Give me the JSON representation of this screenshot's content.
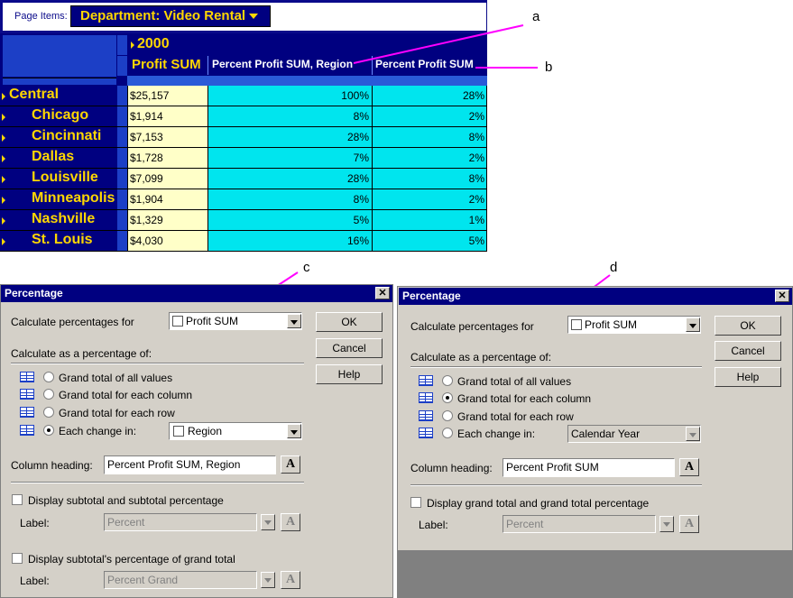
{
  "report": {
    "page_items_label": "Page Items:",
    "department_selector": "Department: Video Rental",
    "year": "2000",
    "columns": [
      "Profit SUM",
      "Percent Profit SUM, Region",
      "Percent Profit SUM"
    ],
    "rows": [
      {
        "label": "Central",
        "profit": "$25,157",
        "pct_region": "100%",
        "pct_total": "28%"
      },
      {
        "label": "Chicago",
        "profit": "$1,914",
        "pct_region": "8%",
        "pct_total": "2%"
      },
      {
        "label": "Cincinnati",
        "profit": "$7,153",
        "pct_region": "28%",
        "pct_total": "8%"
      },
      {
        "label": "Dallas",
        "profit": "$1,728",
        "pct_region": "7%",
        "pct_total": "2%"
      },
      {
        "label": "Louisville",
        "profit": "$7,099",
        "pct_region": "28%",
        "pct_total": "8%"
      },
      {
        "label": "Minneapolis",
        "profit": "$1,904",
        "pct_region": "8%",
        "pct_total": "2%"
      },
      {
        "label": "Nashville",
        "profit": "$1,329",
        "pct_region": "5%",
        "pct_total": "1%"
      },
      {
        "label": "St. Louis",
        "profit": "$4,030",
        "pct_region": "16%",
        "pct_total": "5%"
      }
    ],
    "colors": {
      "navy": "#000080",
      "yellow_label": "#ffd700",
      "money_bg": "#ffffc8",
      "pct_bg": "#00e5ee"
    }
  },
  "callouts": {
    "a": "a",
    "b": "b",
    "c": "c",
    "d": "d",
    "line_color": "#ff00ff"
  },
  "dialog_left": {
    "title": "Percentage",
    "calc_for_label": "Calculate percentages for",
    "calc_for_value": "Profit SUM",
    "calc_as_label": "Calculate as a percentage of:",
    "options": [
      "Grand total of all values",
      "Grand total for each column",
      "Grand total for each row",
      "Each change in:"
    ],
    "selected_option": 3,
    "change_in_value": "Region",
    "column_heading_label": "Column heading:",
    "column_heading_value": "Percent Profit SUM, Region",
    "display_subtotal_label": "Display subtotal and subtotal percentage",
    "label_label": "Label:",
    "label1_value": "Percent",
    "display_grand_label": "Display subtotal's percentage of grand total",
    "label2_value": "Percent Grand",
    "ok": "OK",
    "cancel": "Cancel",
    "help": "Help"
  },
  "dialog_right": {
    "title": "Percentage",
    "calc_for_label": "Calculate percentages for",
    "calc_for_value": "Profit SUM",
    "calc_as_label": "Calculate as a percentage of:",
    "options": [
      "Grand total of all values",
      "Grand total for each column",
      "Grand total for each row",
      "Each change in:"
    ],
    "selected_option": 1,
    "change_in_value": "Calendar Year",
    "column_heading_label": "Column heading:",
    "column_heading_value": "Percent Profit SUM",
    "display_grand_label": "Display grand total and grand total percentage",
    "label_label": "Label:",
    "label_value": "Percent",
    "ok": "OK",
    "cancel": "Cancel",
    "help": "Help"
  }
}
